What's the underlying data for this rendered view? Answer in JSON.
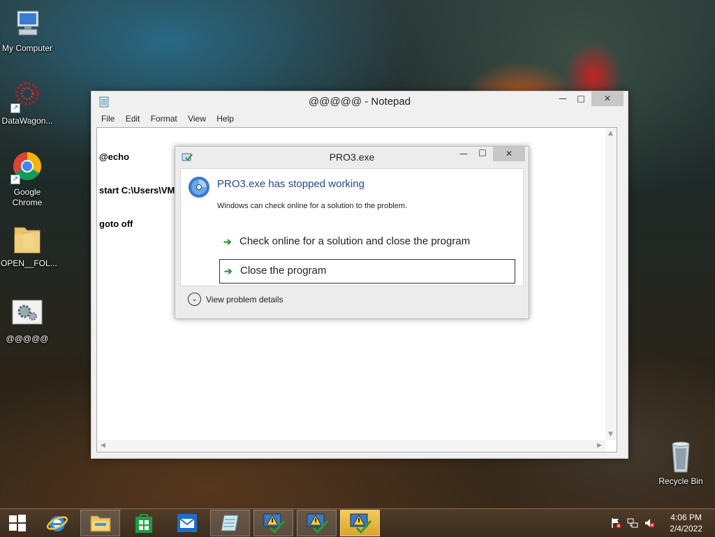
{
  "desktop": {
    "icons": [
      {
        "label": "My Computer",
        "icon": "computer-icon"
      },
      {
        "label": "DataWagon...",
        "icon": "datawagon-icon"
      },
      {
        "label": "Google\nChrome",
        "label_line1": "Google",
        "label_line2": "Chrome",
        "icon": "chrome-icon"
      },
      {
        "label": "OPEN__FOL...",
        "icon": "folder-icon"
      },
      {
        "label": "@@@@@",
        "icon": "settings-file-icon"
      },
      {
        "label": "Recycle Bin",
        "icon": "recycle-bin-icon"
      }
    ]
  },
  "notepad": {
    "title": "@@@@@ - Notepad",
    "menu": [
      "File",
      "Edit",
      "Format",
      "View",
      "Help"
    ],
    "lines": [
      "@echo",
      "start C:\\Users\\VM4\\Desktop\\OPEN__FOLDER__FOR__SETUP\\SETUP__PASS_RAR_1234.exe\\",
      "goto off"
    ]
  },
  "dialog": {
    "title": "PRO3.exe",
    "heading": "PRO3.exe has stopped working",
    "subtext": "Windows can check online for a solution to the problem.",
    "option_check_online": "Check online for a solution and close the program",
    "option_close": "Close the program",
    "details_label": "View problem details"
  },
  "taskbar": {
    "time": "4:06 PM",
    "date": "2/4/2022",
    "buttons": [
      "start-button",
      "internet-explorer",
      "file-explorer",
      "store",
      "mail",
      "notepad",
      "pro3-1",
      "pro3-2",
      "pro3-3"
    ]
  },
  "colors": {
    "dialog_heading": "#1f4a8a",
    "command_arrow": "#2a9a35",
    "taskbar_highlight": "#d9a52c"
  }
}
